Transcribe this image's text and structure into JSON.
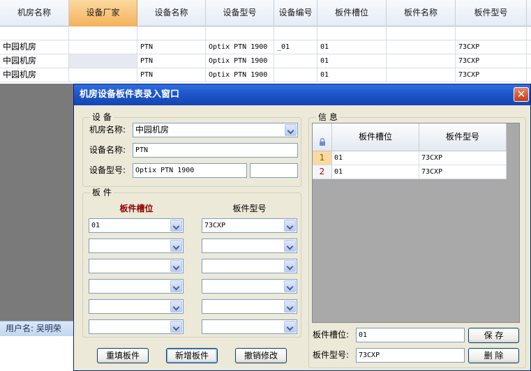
{
  "grid": {
    "columns": [
      "机房名称",
      "设备厂家",
      "设备名称",
      "设备型号",
      "设备编号",
      "板件槽位",
      "板件名称",
      "板件型号"
    ],
    "rows": [
      {
        "room": "",
        "vendor": "",
        "name": "",
        "model": "",
        "serial": "",
        "slot": "",
        "board": "",
        "btype": ""
      },
      {
        "room": "中园机房",
        "vendor": "",
        "name": "PTN",
        "model": "Optix PTN 1900",
        "serial": "_01",
        "slot": "01",
        "board": "",
        "btype": "73CXP"
      },
      {
        "room": "中园机房",
        "vendor": "",
        "name": "PTN",
        "model": "Optix PTN 1900",
        "serial": "",
        "slot": "01",
        "board": "",
        "btype": "73CXP"
      },
      {
        "room": "中园机房",
        "vendor": "",
        "name": "PTN",
        "model": "Optix PTN 1900",
        "serial": "",
        "slot": "01",
        "board": "",
        "btype": "73CXP"
      }
    ]
  },
  "statusbar": {
    "user_label": "用户名:",
    "user_name": "吴明荣"
  },
  "dialog": {
    "title": "机房设备板件表录入窗口",
    "close_glyph": "✕",
    "device_group": {
      "legend": "设 备",
      "room_label": "机房名称:",
      "room_value": "中园机房",
      "device_name_label": "设备名称:",
      "device_name_value": "PTN",
      "device_model_label": "设备型号:",
      "device_model_value": "Optix PTN 1900",
      "device_extra_value": ""
    },
    "board_group": {
      "legend": "板 件",
      "slot_header": "板件槽位",
      "type_header": "板件型号",
      "slot_values": [
        "01",
        "",
        "",
        "",
        "",
        ""
      ],
      "type_values": [
        "73CXP",
        "",
        "",
        "",
        "",
        ""
      ]
    },
    "buttons": {
      "refill": "重填板件",
      "add": "新增板件",
      "undo": "撤销修改"
    },
    "info_group": {
      "legend": "信 息",
      "corner_icon": "lock-icon",
      "columns": [
        "板件槽位",
        "板件型号"
      ],
      "rows": [
        {
          "num": "1",
          "slot": "01",
          "type": "73CXP"
        },
        {
          "num": "2",
          "slot": "01",
          "type": "73CXP"
        }
      ],
      "slot_label": "板件槽位:",
      "slot_value": "01",
      "type_label": "板件型号:",
      "type_value": "73CXP",
      "save_label": "保 存",
      "delete_label": "删 除"
    }
  }
}
